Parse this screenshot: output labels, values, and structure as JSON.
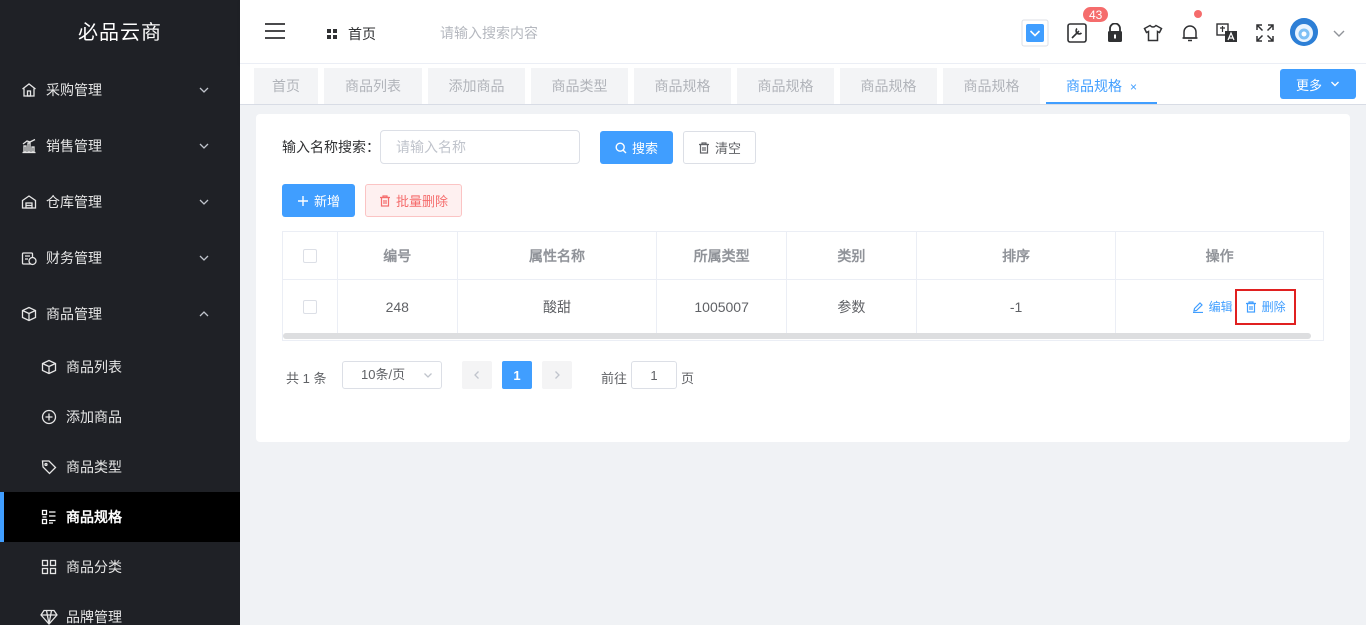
{
  "app": {
    "logo": "必品云商"
  },
  "sidebar": {
    "groups": [
      {
        "label": "采购管理",
        "icon": "store-icon"
      },
      {
        "label": "销售管理",
        "icon": "bar-chart-icon"
      },
      {
        "label": "仓库管理",
        "icon": "warehouse-icon"
      },
      {
        "label": "财务管理",
        "icon": "money-icon"
      },
      {
        "label": "商品管理",
        "icon": "box-icon"
      }
    ],
    "sub_items": [
      {
        "label": "商品列表",
        "icon": "cube-icon"
      },
      {
        "label": "添加商品",
        "icon": "plus-circle-icon"
      },
      {
        "label": "商品类型",
        "icon": "tag-icon"
      },
      {
        "label": "商品规格",
        "icon": "spec-list-icon",
        "active": true
      },
      {
        "label": "商品分类",
        "icon": "grid-icon"
      },
      {
        "label": "品牌管理",
        "icon": "diamond-icon"
      }
    ]
  },
  "header": {
    "home": "首页",
    "search_placeholder": "请输入搜索内容",
    "badge_count": "43"
  },
  "tags": [
    {
      "label": "首页"
    },
    {
      "label": "商品列表"
    },
    {
      "label": "添加商品"
    },
    {
      "label": "商品类型"
    },
    {
      "label": "商品规格"
    },
    {
      "label": "商品规格"
    },
    {
      "label": "商品规格"
    },
    {
      "label": "商品规格"
    },
    {
      "label": "商品规格",
      "active": true,
      "close": "×"
    }
  ],
  "more_label": "更多",
  "filter": {
    "label": "输入名称搜索：",
    "placeholder": "请输入名称",
    "search_label": "搜索",
    "clear_label": "清空",
    "add_label": "新增",
    "batch_delete_label": "批量删除"
  },
  "table": {
    "headers": [
      "",
      "编号",
      "属性名称",
      "所属类型",
      "类别",
      "排序",
      "操作"
    ],
    "rows": [
      {
        "id": "248",
        "name": "酸甜",
        "type": "1005007",
        "category": "参数",
        "sort": "-1",
        "edit": "编辑",
        "delete": "删除"
      }
    ]
  },
  "pager": {
    "total": "共 1 条",
    "page_size": "10条/页",
    "current": "1",
    "goto_label": "前往",
    "goto_value": "1",
    "page_unit": "页"
  },
  "colors": {
    "primary": "#409eff",
    "danger": "#f56c6c",
    "sidebar_bg": "#1f2126",
    "highlight_box": "#e02020"
  }
}
